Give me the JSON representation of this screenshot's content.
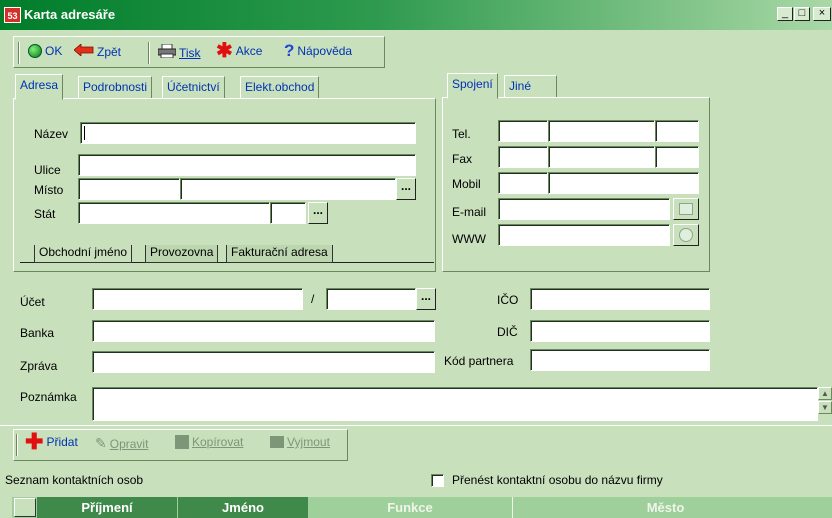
{
  "window": {
    "title": "Karta adresáře",
    "app_icon_text": "53",
    "controls": {
      "minimize": "_",
      "maximize": "□",
      "close": "×"
    }
  },
  "toolbar": {
    "ok": "OK",
    "back": "Zpět",
    "print": "Tisk",
    "action": "Akce",
    "help": "Nápověda"
  },
  "left_tabs": [
    "Adresa",
    "Podrobnosti",
    "Účetnictví",
    "Elekt.obchod"
  ],
  "right_tabs": [
    "Spojení",
    "Jiné"
  ],
  "address": {
    "name_label": "Název",
    "street_label": "Ulice",
    "city_label": "Místo",
    "country_label": "Stát",
    "browse": "..."
  },
  "address_subtabs": [
    "Obchodní jméno",
    "Provozovna",
    "Fakturační adresa"
  ],
  "contact": {
    "tel_label": "Tel.",
    "fax_label": "Fax",
    "mobile_label": "Mobil",
    "email_label": "E-mail",
    "www_label": "WWW"
  },
  "account": {
    "account_label": "Účet",
    "slash": "/",
    "bank_label": "Banka",
    "message_label": "Zpráva",
    "ico_label": "IČO",
    "dic_label": "DIČ",
    "partner_code_label": "Kód partnera",
    "note_label": "Poznámka"
  },
  "contacts_toolbar": {
    "add": "Přidat",
    "edit": "Opravit",
    "copy": "Kopírovat",
    "cut": "Vyjmout"
  },
  "contacts": {
    "list_label": "Seznam kontaktních osob",
    "transfer_checkbox_label": "Přenést kontaktní osobu do názvu firmy",
    "transfer_checked": false,
    "columns": [
      "Příjmení",
      "Jméno",
      "Funkce",
      "Město"
    ]
  },
  "colors": {
    "background": "#c8e0bc",
    "title_dark": "#007d2a",
    "link_blue": "#0032b4",
    "header_active": "#3f8a4a",
    "header_inactive": "#9fcf9a"
  }
}
